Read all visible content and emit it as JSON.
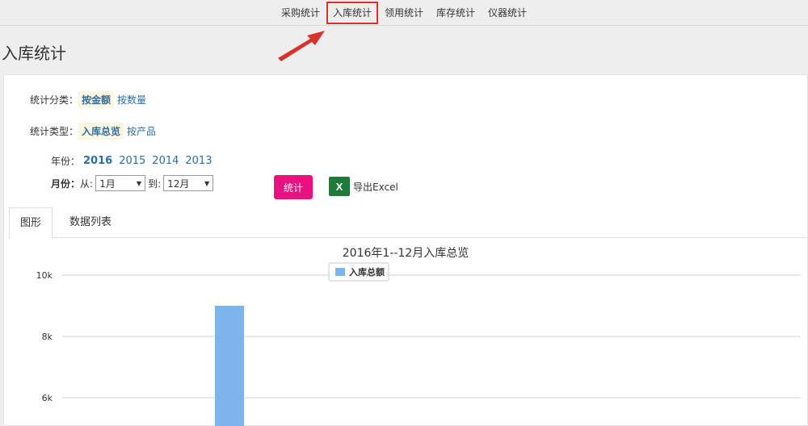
{
  "nav": {
    "items": [
      "采购统计",
      "入库统计",
      "领用统计",
      "库存统计",
      "仪器统计"
    ],
    "highlighted": 1
  },
  "page_title": "入库统计",
  "filters": {
    "category_label": "统计分类：",
    "category_options": [
      "按金额",
      "按数量"
    ],
    "category_selected": 0,
    "type_label": "统计类型：",
    "type_options": [
      "入库总览",
      "按产品"
    ],
    "type_selected": 0,
    "year_label": "年份：",
    "years": [
      "2016",
      "2015",
      "2014",
      "2013"
    ],
    "year_selected": 0,
    "month_label": "月份：",
    "from_label": "从:",
    "from_value": "1月",
    "to_label": "到:",
    "to_value": "12月"
  },
  "actions": {
    "stat_button": "统计",
    "export_label": "导出Excel",
    "excel_icon_text": "X"
  },
  "tabs": [
    "图形",
    "数据列表"
  ],
  "active_tab": 0,
  "chart_data": {
    "type": "bar",
    "title": "2016年1--12月入库总览",
    "series": [
      {
        "name": "入库总额",
        "values": [
          0,
          0,
          0,
          0,
          9000,
          0,
          0,
          0,
          0,
          0,
          0,
          0
        ]
      }
    ],
    "yticks": [
      "10k",
      "8k",
      "6k"
    ],
    "ylim_visible": [
      5900,
      10000
    ],
    "grid": true,
    "legend": "top-center",
    "color": "#7cb5ec"
  }
}
